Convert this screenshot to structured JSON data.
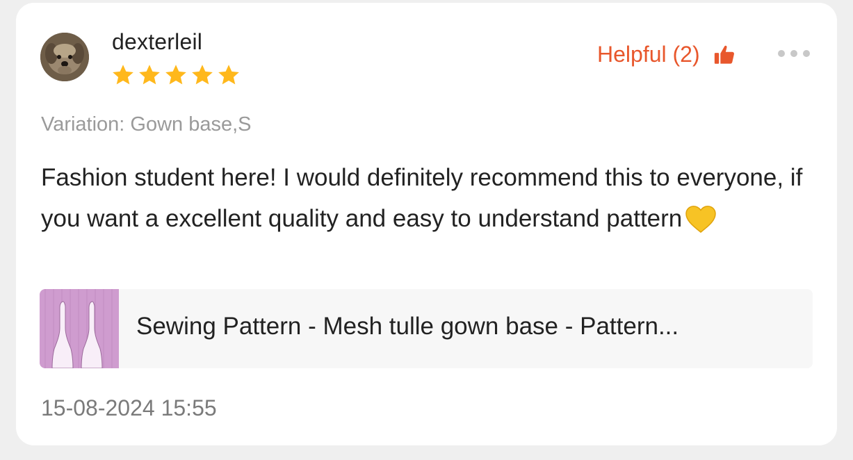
{
  "review": {
    "username": "dexterleil",
    "rating": 5,
    "helpful_label": "Helpful (2)",
    "variation": "Variation: Gown base,S",
    "text": "Fashion student here! I would definitely recommend this to everyone, if you want a excellent quality and easy to understand pattern",
    "date": "15-08-2024 15:55"
  },
  "product": {
    "name": "Sewing Pattern - Mesh tulle gown base - Pattern..."
  },
  "icons": {
    "avatar": "dog-avatar",
    "stars": "star-icon",
    "helpful": "thumbs-up-icon",
    "more": "more-horizontal-icon",
    "heart": "yellow-heart-emoji"
  },
  "colors": {
    "accent": "#e8572c",
    "star": "#ffb81c",
    "muted_text": "#9a9a9a",
    "card_bg": "#ffffff",
    "page_bg": "#efefef"
  }
}
